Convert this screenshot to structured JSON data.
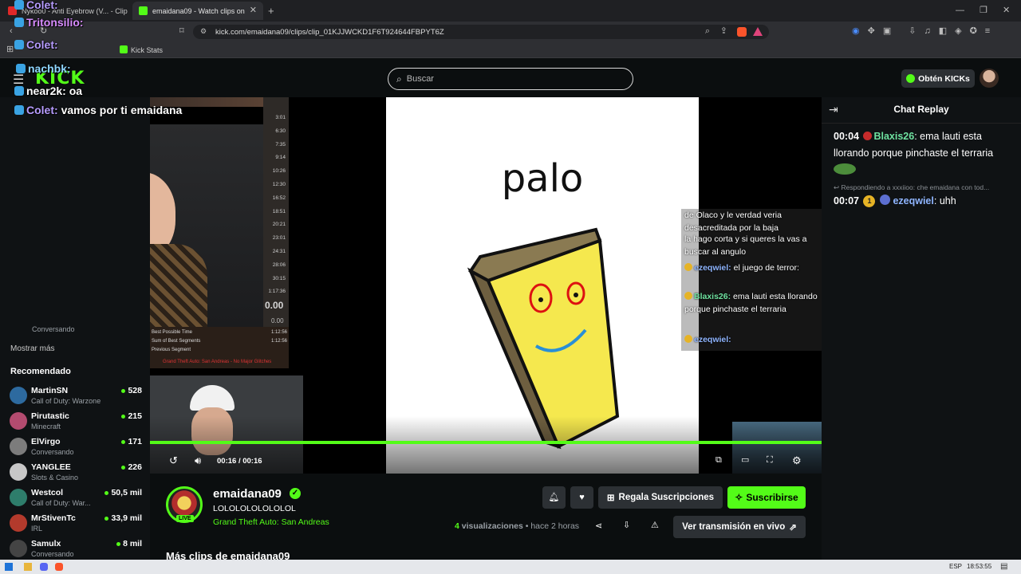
{
  "browser": {
    "tabs": [
      {
        "label": "Nykoo0 - Anti Eyebrow (V... - Clip"
      },
      {
        "label": "emaidana09 - Watch clips on Kick"
      },
      {
        "label": "Kick Stats"
      }
    ],
    "new_tab": "+",
    "url": "kick.com/emaidana09/clips/clip_01KJJWCKD1F6T924644FBPYT6Z"
  },
  "header": {
    "search_placeholder": "Buscar",
    "get_kicks_label": "Obtén KICKs",
    "logo": "KICK"
  },
  "overlay_chat": [
    {
      "user": "Colet:",
      "text": ""
    },
    {
      "user": "Tritonsilio:",
      "text": ""
    },
    {
      "user": "Colet:",
      "text": ""
    },
    {
      "user": "nachbk:",
      "text": ""
    },
    {
      "user": "near2k:",
      "text": "oa"
    },
    {
      "user": "Colet:",
      "text": "vamos por ti emaidana"
    }
  ],
  "sidebar": {
    "partial_item_status": "Conversando",
    "show_more": "Mostrar más",
    "recommended_title": "Recomendado",
    "recommended": [
      {
        "name": "MartinSN",
        "game": "Call of Duty: Warzone",
        "viewers": "528",
        "color": "#2d6a9f"
      },
      {
        "name": "Pirutastic",
        "game": "Minecraft",
        "viewers": "215",
        "color": "#b34b6f"
      },
      {
        "name": "ElVirgo",
        "game": "Conversando",
        "viewers": "171",
        "color": "#7c7c7c"
      },
      {
        "name": "YANGLEE",
        "game": "Slots & Casino",
        "viewers": "226",
        "color": "#c7c7c7"
      },
      {
        "name": "Westcol",
        "game": "Call of Duty: War...",
        "viewers": "50,5 mil",
        "color": "#2e7d6b"
      },
      {
        "name": "MrStivenTc",
        "game": "IRL",
        "viewers": "33,9 mil",
        "color": "#b33a2c"
      },
      {
        "name": "Samulx",
        "game": "Conversando",
        "viewers": "8 mil",
        "color": "#444"
      }
    ]
  },
  "video": {
    "stage_word": "palo",
    "time_current": "00:16",
    "time_sep": "/",
    "time_total": "00:16",
    "progress": 1.0,
    "splits": [
      "3:01",
      "6:30",
      "7:35",
      "9:14",
      "10:26",
      "12:30",
      "16:52",
      "18:51",
      "20:21",
      "23:01",
      "24:31",
      "28:06",
      "30:15",
      "1:17:36"
    ],
    "split_big": "0.00",
    "split_small": "0.00",
    "split_labels": [
      {
        "label": "Best Possible Time",
        "value": "1:12:56"
      },
      {
        "label": "Sum of Best Segments",
        "value": "1:12:56"
      },
      {
        "label": "Previous Segment",
        "value": ""
      }
    ],
    "split_footer": "Grand Theft Auto: San Andreas - No Major Glitches",
    "inner_chat": [
      {
        "user": "",
        "text": "de Olaco y le verdad veria desacreditada por",
        "tail": "la baja"
      },
      {
        "user": "",
        "text": "la hago corta y si queres la vas a buscar al angulo",
        "tail": ""
      },
      {
        "user": "ezeqwiel:",
        "text": "el juego de terror:",
        "tail": ""
      },
      {
        "user": "Blaxis26:",
        "text": "ema lauti esta llorando porque pinchaste el terraria",
        "tail": ""
      },
      {
        "user": "ezeqwiel:",
        "text": "",
        "tail": ""
      }
    ]
  },
  "chat": {
    "title": "Chat Replay",
    "reply_hint": "Respondiendo a xxxiioo: che emaidana con tod...",
    "messages": [
      {
        "time": "00:04",
        "user": "Blaxis26",
        "user_color": "#6fe3a1",
        "text": "ema lauti esta llorando porque pinchaste el terraria"
      },
      {
        "time": "00:07",
        "user": "ezeqwiel",
        "user_color": "#8fb5ff",
        "text": "uhh",
        "badge": "1"
      }
    ]
  },
  "stream": {
    "channel": "emaidana09",
    "title": "LOLOLOLOLOLOLOL",
    "category": "Grand Theft Auto: San Andreas",
    "live_badge": "LIVE",
    "gift_subs_label": "Regala Suscripciones",
    "subscribe_label": "Suscribirse",
    "views_count": "4",
    "views_label": "visualizaciones",
    "time_ago": "hace 2 horas",
    "watch_live_label": "Ver transmisión en vivo",
    "more_clips": "Más clips de emaidana09"
  },
  "taskbar": {
    "lang": "ESP",
    "clock": "18:53:55"
  },
  "colors": {
    "accent": "#53fc18",
    "bg": "#0b0e0f",
    "panel": "#0f1214"
  }
}
